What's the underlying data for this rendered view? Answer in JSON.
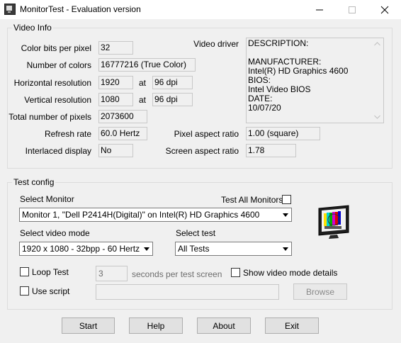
{
  "window": {
    "title": "MonitorTest - Evaluation version"
  },
  "video_info": {
    "title": "Video Info",
    "color_bits_label": "Color bits per pixel",
    "color_bits_value": "32",
    "num_colors_label": "Number of colors",
    "num_colors_value": "16777216 (True Color)",
    "h_res_label": "Horizontal resolution",
    "h_res_value": "1920",
    "h_at": "at",
    "h_dpi": "96 dpi",
    "v_res_label": "Vertical resolution",
    "v_res_value": "1080",
    "v_at": "at",
    "v_dpi": "96 dpi",
    "total_pixels_label": "Total number of pixels",
    "total_pixels_value": "2073600",
    "refresh_label": "Refresh rate",
    "refresh_value": "60.0 Hertz",
    "interlaced_label": "Interlaced display",
    "interlaced_value": "No",
    "driver_label": "Video driver",
    "driver_text": "DESCRIPTION:\n\nMANUFACTURER:\nIntel(R) HD Graphics 4600\nBIOS:\nIntel Video BIOS\nDATE:\n10/07/20",
    "pixel_aspect_label": "Pixel aspect ratio",
    "pixel_aspect_value": "1.00 (square)",
    "screen_aspect_label": "Screen aspect ratio",
    "screen_aspect_value": "1.78"
  },
  "test_config": {
    "title": "Test config",
    "select_monitor_label": "Select Monitor",
    "test_all_label": "Test All Monitors",
    "monitor_value": "Monitor 1, \"Dell P2414H(Digital)\" on Intel(R) HD Graphics 4600",
    "video_mode_label": "Select video mode",
    "video_mode_value": "1920 x 1080 - 32bpp - 60 Hertz",
    "select_test_label": "Select test",
    "select_test_value": "All Tests",
    "loop_test_label": "Loop Test",
    "seconds_value": "3",
    "seconds_label": "seconds per test screen",
    "show_details_label": "Show video mode details",
    "use_script_label": "Use script",
    "script_value": "",
    "browse_label": "Browse"
  },
  "buttons": {
    "start": "Start",
    "help": "Help",
    "about": "About",
    "exit": "Exit"
  },
  "icons": {
    "app": "monitor-app-icon",
    "monitor_graphic": "test-pattern-monitor-icon"
  }
}
